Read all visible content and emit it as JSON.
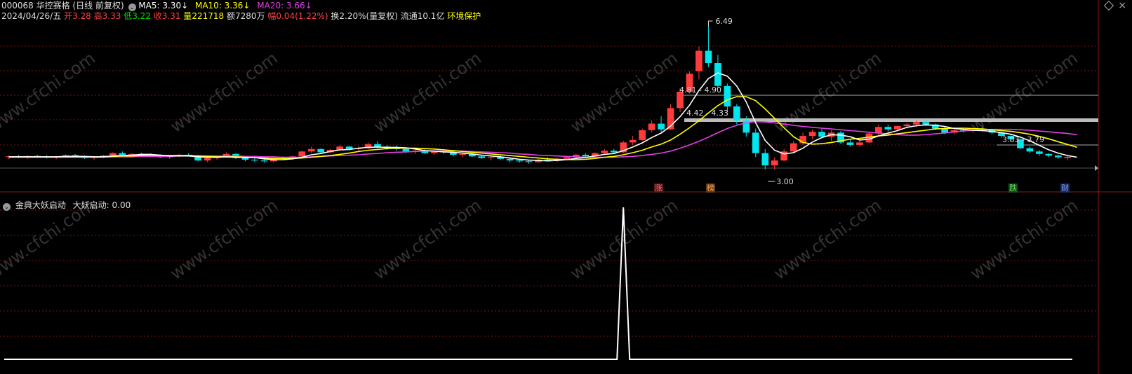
{
  "header": {
    "code": "000068",
    "name": "华控赛格",
    "period": "(日线 前复权)",
    "ma5_label": "MA5: 3.30↓",
    "ma10_label": "MA10: 3.36↓",
    "ma20_label": "MA20: 3.66↓",
    "date": "2024/04/26/五",
    "open_label": "开",
    "open": "3.28",
    "high_label": "高",
    "high": "3.33",
    "low_label": "低",
    "low": "3.22",
    "close_label": "收",
    "close": "3.31",
    "vol_label": "量",
    "vol": "221718",
    "amt_label": "额",
    "amt": "7280万",
    "chg_label": "幅",
    "chg": "0.04(1.22%)",
    "turnover": "换2.20%(量复权)",
    "float": "流通10.1亿",
    "tag": "环境保护"
  },
  "indicator": {
    "name": "金典大妖启动",
    "series_label": "大妖启动: 0.00"
  },
  "annotations": {
    "peak": "6.49",
    "low": "3.00",
    "range1": "4.81 - 4.90",
    "range2": "4.42 - 4.33",
    "range3": "3.83 - 3.79"
  },
  "badges": [
    {
      "text": "涨",
      "color": "#e05050"
    },
    {
      "text": "榜",
      "color": "#c08040"
    },
    {
      "text": "跌",
      "color": "#30a030"
    },
    {
      "text": "财",
      "color": "#4070c0"
    }
  ],
  "watermark": "www.cfchi.com",
  "colors": {
    "up": "#ff3b3b",
    "down": "#00e5ee",
    "ma5": "#ffffff",
    "ma10": "#ffff00",
    "ma20": "#e040e0",
    "grid": "#7a1515"
  },
  "chart_data": {
    "type": "candlestick",
    "ohlc": [
      [
        3.3,
        3.35,
        3.25,
        3.32
      ],
      [
        3.32,
        3.36,
        3.28,
        3.3
      ],
      [
        3.3,
        3.34,
        3.26,
        3.33
      ],
      [
        3.33,
        3.36,
        3.29,
        3.31
      ],
      [
        3.31,
        3.35,
        3.27,
        3.29
      ],
      [
        3.29,
        3.33,
        3.25,
        3.32
      ],
      [
        3.32,
        3.37,
        3.3,
        3.35
      ],
      [
        3.35,
        3.38,
        3.3,
        3.31
      ],
      [
        3.31,
        3.34,
        3.26,
        3.28
      ],
      [
        3.28,
        3.33,
        3.24,
        3.3
      ],
      [
        3.3,
        3.36,
        3.28,
        3.34
      ],
      [
        3.34,
        3.42,
        3.32,
        3.4
      ],
      [
        3.4,
        3.44,
        3.34,
        3.36
      ],
      [
        3.36,
        3.4,
        3.32,
        3.38
      ],
      [
        3.38,
        3.41,
        3.33,
        3.35
      ],
      [
        3.35,
        3.39,
        3.3,
        3.33
      ],
      [
        3.33,
        3.37,
        3.28,
        3.3
      ],
      [
        3.3,
        3.34,
        3.26,
        3.32
      ],
      [
        3.32,
        3.38,
        3.3,
        3.36
      ],
      [
        3.36,
        3.4,
        3.32,
        3.34
      ],
      [
        3.34,
        3.36,
        3.2,
        3.22
      ],
      [
        3.22,
        3.3,
        3.18,
        3.28
      ],
      [
        3.28,
        3.34,
        3.24,
        3.32
      ],
      [
        3.32,
        3.42,
        3.3,
        3.38
      ],
      [
        3.38,
        3.4,
        3.26,
        3.28
      ],
      [
        3.28,
        3.3,
        3.2,
        3.24
      ],
      [
        3.24,
        3.28,
        3.18,
        3.22
      ],
      [
        3.22,
        3.26,
        3.16,
        3.2
      ],
      [
        3.2,
        3.3,
        3.18,
        3.28
      ],
      [
        3.28,
        3.32,
        3.22,
        3.26
      ],
      [
        3.26,
        3.34,
        3.24,
        3.32
      ],
      [
        3.32,
        3.46,
        3.3,
        3.44
      ],
      [
        3.44,
        3.56,
        3.4,
        3.5
      ],
      [
        3.5,
        3.52,
        3.38,
        3.42
      ],
      [
        3.42,
        3.5,
        3.4,
        3.48
      ],
      [
        3.48,
        3.6,
        3.46,
        3.56
      ],
      [
        3.56,
        3.58,
        3.46,
        3.5
      ],
      [
        3.5,
        3.56,
        3.44,
        3.52
      ],
      [
        3.52,
        3.66,
        3.5,
        3.62
      ],
      [
        3.62,
        3.7,
        3.52,
        3.56
      ],
      [
        3.56,
        3.6,
        3.48,
        3.52
      ],
      [
        3.52,
        3.58,
        3.46,
        3.5
      ],
      [
        3.5,
        3.52,
        3.4,
        3.44
      ],
      [
        3.44,
        3.5,
        3.38,
        3.46
      ],
      [
        3.46,
        3.5,
        3.38,
        3.4
      ],
      [
        3.4,
        3.46,
        3.36,
        3.44
      ],
      [
        3.44,
        3.48,
        3.38,
        3.42
      ],
      [
        3.42,
        3.44,
        3.32,
        3.36
      ],
      [
        3.36,
        3.4,
        3.3,
        3.38
      ],
      [
        3.38,
        3.42,
        3.3,
        3.32
      ],
      [
        3.32,
        3.36,
        3.26,
        3.28
      ],
      [
        3.28,
        3.32,
        3.22,
        3.3
      ],
      [
        3.3,
        3.34,
        3.24,
        3.26
      ],
      [
        3.26,
        3.28,
        3.18,
        3.22
      ],
      [
        3.22,
        3.26,
        3.16,
        3.2
      ],
      [
        3.2,
        3.24,
        3.14,
        3.18
      ],
      [
        3.18,
        3.26,
        3.16,
        3.24
      ],
      [
        3.24,
        3.3,
        3.2,
        3.22
      ],
      [
        3.22,
        3.28,
        3.18,
        3.26
      ],
      [
        3.26,
        3.34,
        3.24,
        3.3
      ],
      [
        3.3,
        3.38,
        3.28,
        3.36
      ],
      [
        3.36,
        3.4,
        3.3,
        3.32
      ],
      [
        3.32,
        3.42,
        3.3,
        3.4
      ],
      [
        3.4,
        3.5,
        3.36,
        3.46
      ],
      [
        3.46,
        3.5,
        3.38,
        3.42
      ],
      [
        3.42,
        3.7,
        3.4,
        3.66
      ],
      [
        3.66,
        3.82,
        3.6,
        3.72
      ],
      [
        3.72,
        4.0,
        3.7,
        3.96
      ],
      [
        3.96,
        4.2,
        3.9,
        4.12
      ],
      [
        4.12,
        4.3,
        3.9,
        3.98
      ],
      [
        3.98,
        4.6,
        3.96,
        4.5
      ],
      [
        4.5,
        4.98,
        4.4,
        4.9
      ],
      [
        4.9,
        5.4,
        4.86,
        5.34
      ],
      [
        5.4,
        6.0,
        5.2,
        5.9
      ],
      [
        5.9,
        6.49,
        5.5,
        5.6
      ],
      [
        5.6,
        5.8,
        5.0,
        5.04
      ],
      [
        5.04,
        5.1,
        4.4,
        4.54
      ],
      [
        4.54,
        4.6,
        4.1,
        4.2
      ],
      [
        4.2,
        4.3,
        3.8,
        3.9
      ],
      [
        3.9,
        4.0,
        3.3,
        3.4
      ],
      [
        3.4,
        3.5,
        3.0,
        3.1
      ],
      [
        3.1,
        3.3,
        3.0,
        3.22
      ],
      [
        3.22,
        3.5,
        3.2,
        3.44
      ],
      [
        3.44,
        3.7,
        3.42,
        3.64
      ],
      [
        3.64,
        3.9,
        3.6,
        3.82
      ],
      [
        3.82,
        3.98,
        3.74,
        3.92
      ],
      [
        3.92,
        4.0,
        3.76,
        3.8
      ],
      [
        3.8,
        3.96,
        3.7,
        3.9
      ],
      [
        3.9,
        3.94,
        3.62,
        3.66
      ],
      [
        3.66,
        3.72,
        3.56,
        3.6
      ],
      [
        3.6,
        3.7,
        3.56,
        3.66
      ],
      [
        3.66,
        3.92,
        3.64,
        3.88
      ],
      [
        3.88,
        4.1,
        3.82,
        4.04
      ],
      [
        4.04,
        4.1,
        3.92,
        3.98
      ],
      [
        3.98,
        4.08,
        3.94,
        4.06
      ],
      [
        4.06,
        4.14,
        4.0,
        4.1
      ],
      [
        4.1,
        4.2,
        4.04,
        4.16
      ],
      [
        4.16,
        4.22,
        4.06,
        4.1
      ],
      [
        4.1,
        4.12,
        3.96,
        4.0
      ],
      [
        4.0,
        4.04,
        3.86,
        3.9
      ],
      [
        3.9,
        4.0,
        3.86,
        3.96
      ],
      [
        3.96,
        4.02,
        3.9,
        3.94
      ],
      [
        3.94,
        4.0,
        3.9,
        3.98
      ],
      [
        3.98,
        4.04,
        3.92,
        3.96
      ],
      [
        3.96,
        3.98,
        3.86,
        3.9
      ],
      [
        3.9,
        3.92,
        3.78,
        3.82
      ],
      [
        3.82,
        3.86,
        3.7,
        3.74
      ],
      [
        3.74,
        3.76,
        3.5,
        3.52
      ],
      [
        3.52,
        3.56,
        3.4,
        3.44
      ],
      [
        3.44,
        3.48,
        3.34,
        3.38
      ],
      [
        3.38,
        3.4,
        3.3,
        3.34
      ],
      [
        3.34,
        3.36,
        3.26,
        3.3
      ],
      [
        3.28,
        3.33,
        3.22,
        3.31
      ]
    ],
    "ma5": [
      3.31,
      3.31,
      3.31,
      3.31,
      3.31,
      3.31,
      3.32,
      3.32,
      3.32,
      3.31,
      3.31,
      3.33,
      3.34,
      3.35,
      3.37,
      3.37,
      3.35,
      3.33,
      3.33,
      3.33,
      3.31,
      3.3,
      3.3,
      3.31,
      3.3,
      3.29,
      3.29,
      3.26,
      3.24,
      3.24,
      3.26,
      3.3,
      3.36,
      3.39,
      3.44,
      3.48,
      3.49,
      3.52,
      3.54,
      3.55,
      3.54,
      3.54,
      3.53,
      3.5,
      3.46,
      3.45,
      3.43,
      3.42,
      3.4,
      3.38,
      3.35,
      3.33,
      3.31,
      3.28,
      3.25,
      3.23,
      3.22,
      3.21,
      3.22,
      3.24,
      3.27,
      3.29,
      3.33,
      3.37,
      3.39,
      3.46,
      3.55,
      3.65,
      3.78,
      3.89,
      4.06,
      4.29,
      4.57,
      4.93,
      5.22,
      5.36,
      5.28,
      5.04,
      4.65,
      4.14,
      3.71,
      3.47,
      3.38,
      3.41,
      3.52,
      3.67,
      3.78,
      3.85,
      3.84,
      3.8,
      3.72,
      3.74,
      3.82,
      3.89,
      3.95,
      4.03,
      4.07,
      4.09,
      4.08,
      4.05,
      4.0,
      3.98,
      3.96,
      3.95,
      3.93,
      3.9,
      3.86,
      3.79,
      3.7,
      3.59,
      3.48,
      3.4,
      3.34,
      3.3
    ],
    "ma10": [
      3.31,
      3.31,
      3.31,
      3.31,
      3.31,
      3.31,
      3.31,
      3.31,
      3.31,
      3.31,
      3.31,
      3.32,
      3.33,
      3.33,
      3.34,
      3.35,
      3.34,
      3.34,
      3.34,
      3.34,
      3.33,
      3.32,
      3.31,
      3.31,
      3.31,
      3.3,
      3.29,
      3.28,
      3.27,
      3.27,
      3.27,
      3.28,
      3.3,
      3.32,
      3.34,
      3.37,
      3.4,
      3.44,
      3.47,
      3.49,
      3.51,
      3.52,
      3.52,
      3.52,
      3.51,
      3.5,
      3.48,
      3.46,
      3.44,
      3.42,
      3.4,
      3.38,
      3.36,
      3.34,
      3.32,
      3.3,
      3.28,
      3.26,
      3.25,
      3.24,
      3.24,
      3.25,
      3.27,
      3.3,
      3.32,
      3.36,
      3.41,
      3.47,
      3.55,
      3.62,
      3.72,
      3.86,
      4.02,
      4.19,
      4.38,
      4.56,
      4.7,
      4.78,
      4.78,
      4.68,
      4.48,
      4.25,
      4.02,
      3.8,
      3.66,
      3.62,
      3.63,
      3.66,
      3.7,
      3.74,
      3.76,
      3.79,
      3.82,
      3.84,
      3.87,
      3.9,
      3.93,
      3.96,
      3.99,
      4.0,
      4.01,
      4.01,
      4.0,
      3.99,
      3.97,
      3.95,
      3.93,
      3.9,
      3.86,
      3.81,
      3.75,
      3.68,
      3.61,
      3.54
    ],
    "ma20": [
      3.3,
      3.3,
      3.3,
      3.3,
      3.3,
      3.3,
      3.3,
      3.3,
      3.3,
      3.3,
      3.3,
      3.31,
      3.31,
      3.31,
      3.32,
      3.32,
      3.32,
      3.32,
      3.33,
      3.33,
      3.33,
      3.33,
      3.33,
      3.33,
      3.33,
      3.32,
      3.32,
      3.31,
      3.31,
      3.3,
      3.3,
      3.3,
      3.31,
      3.32,
      3.33,
      3.34,
      3.35,
      3.36,
      3.38,
      3.39,
      3.41,
      3.42,
      3.43,
      3.44,
      3.45,
      3.45,
      3.45,
      3.45,
      3.45,
      3.44,
      3.43,
      3.42,
      3.41,
      3.4,
      3.38,
      3.37,
      3.35,
      3.34,
      3.33,
      3.32,
      3.31,
      3.3,
      3.3,
      3.3,
      3.3,
      3.31,
      3.32,
      3.34,
      3.37,
      3.4,
      3.45,
      3.52,
      3.6,
      3.69,
      3.79,
      3.9,
      4.0,
      4.08,
      4.14,
      4.17,
      4.16,
      4.14,
      4.11,
      4.08,
      4.05,
      4.03,
      4.01,
      3.99,
      3.97,
      3.95,
      3.93,
      3.91,
      3.89,
      3.87,
      3.85,
      3.84,
      3.84,
      3.85,
      3.87,
      3.89,
      3.92,
      3.94,
      3.96,
      3.97,
      3.98,
      3.98,
      3.98,
      3.97,
      3.96,
      3.94,
      3.92,
      3.9,
      3.88,
      3.85
    ],
    "indicator": {
      "spike_index": 65,
      "spike_value": 1,
      "ylim": [
        0,
        1
      ]
    },
    "ylim": [
      3.0,
      6.49
    ]
  }
}
